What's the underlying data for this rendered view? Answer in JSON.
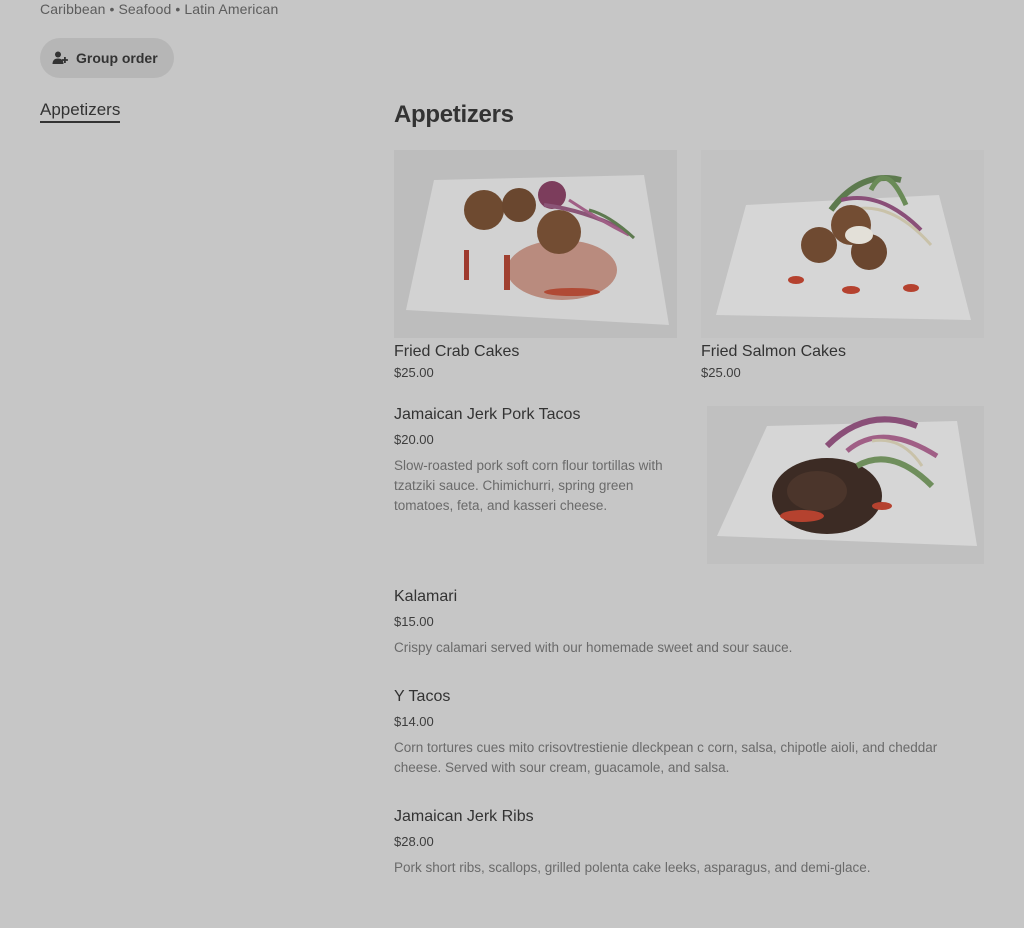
{
  "header": {
    "cuisines": "Caribbean • Seafood • Latin American",
    "group_order_label": "Group order"
  },
  "side_nav": {
    "items": [
      {
        "label": "Appetizers"
      }
    ]
  },
  "menu": {
    "section_title": "Appetizers",
    "featured": [
      {
        "name": "Fried Crab Cakes",
        "price": "$25.00"
      },
      {
        "name": "Fried Salmon Cakes",
        "price": "$25.00"
      }
    ],
    "items": [
      {
        "name": "Jamaican Jerk Pork Tacos",
        "price": "$20.00",
        "description": "Slow-roasted pork soft corn flour tortillas with tzatziki sauce. Chimichurri, spring green tomatoes, feta, and kasseri cheese."
      },
      {
        "name": "Kalamari",
        "price": "$15.00",
        "description": "Crispy calamari served with our homemade sweet and sour sauce."
      },
      {
        "name": "Y Tacos",
        "price": "$14.00",
        "description": "Corn tortures cues mito crisovtrestienie dleckpean c corn, salsa, chipotle aioli, and cheddar cheese. Served with sour cream, guacamole, and salsa."
      },
      {
        "name": "Jamaican Jerk Ribs",
        "price": "$28.00",
        "description": "Pork short ribs, scallops, grilled polenta cake leeks, asparagus, and demi-glace."
      }
    ]
  },
  "icons": {
    "group_order": "person-add-icon"
  }
}
